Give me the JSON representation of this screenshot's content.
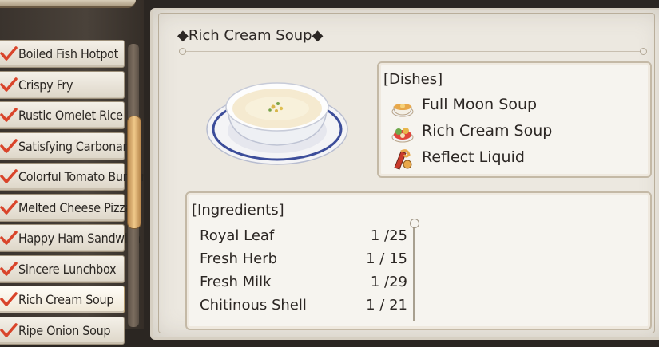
{
  "recipe_list": {
    "items": [
      {
        "label": "Boiled Fish Hotpot",
        "checked": true,
        "selected": false
      },
      {
        "label": "Crispy Fry",
        "checked": true,
        "selected": false
      },
      {
        "label": "Rustic Omelet Rice",
        "checked": true,
        "selected": false
      },
      {
        "label": "Satisfying Carbonara",
        "checked": true,
        "selected": false
      },
      {
        "label": "Colorful Tomato Burger",
        "checked": true,
        "selected": false
      },
      {
        "label": "Melted Cheese Pizza",
        "checked": true,
        "selected": false
      },
      {
        "label": "Happy Ham Sandwich",
        "checked": true,
        "selected": false
      },
      {
        "label": "Sincere Lunchbox",
        "checked": true,
        "selected": false
      },
      {
        "label": "Rich Cream Soup",
        "checked": true,
        "selected": true
      },
      {
        "label": "Ripe Onion Soup",
        "checked": true,
        "selected": false
      }
    ]
  },
  "detail": {
    "title": "◆Rich Cream Soup◆",
    "dishes_header": "[Dishes]",
    "dishes": [
      {
        "label": "Full Moon Soup",
        "icon": "soup-bowl-icon"
      },
      {
        "label": "Rich Cream Soup",
        "icon": "cream-soup-icon"
      },
      {
        "label": "Reflect Liquid",
        "icon": "potion-icon"
      }
    ],
    "ingredients_header": "[Ingredients]",
    "ingredients": [
      {
        "name": "Royal Leaf",
        "qty": "1 /25"
      },
      {
        "name": "Fresh Herb",
        "qty": "1 / 15"
      },
      {
        "name": "Fresh Milk",
        "qty": "1 /29"
      },
      {
        "name": "Chitinous Shell",
        "qty": "1 / 21"
      }
    ]
  },
  "colors": {
    "check": "#d9442a",
    "accent": "#e9b774",
    "text": "#2c2724"
  }
}
